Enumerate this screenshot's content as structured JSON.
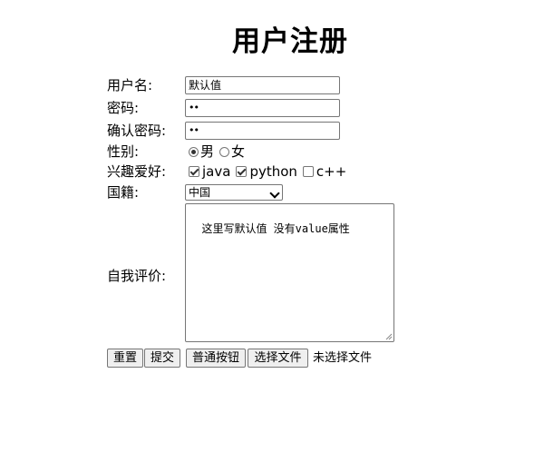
{
  "title": "用户注册",
  "username": {
    "label": "用户名:",
    "value": "默认值"
  },
  "password": {
    "label": "密码:",
    "value": "••"
  },
  "confirm": {
    "label": "确认密码:",
    "value": "••"
  },
  "gender": {
    "label": "性别:",
    "options": [
      "男",
      "女"
    ],
    "selected": "男"
  },
  "hobbies": {
    "label": "兴趣爱好:",
    "options": [
      {
        "label": "java",
        "checked": true
      },
      {
        "label": "python",
        "checked": true
      },
      {
        "label": "c++",
        "checked": false
      }
    ]
  },
  "nationality": {
    "label": "国籍:",
    "selected": "中国"
  },
  "evaluation": {
    "label": "自我评价:",
    "value": "这里写默认值 没有value属性"
  },
  "buttons": {
    "reset": "重置",
    "submit": "提交",
    "normal": "普通按钮",
    "file": "选择文件"
  },
  "file_status": "未选择文件"
}
